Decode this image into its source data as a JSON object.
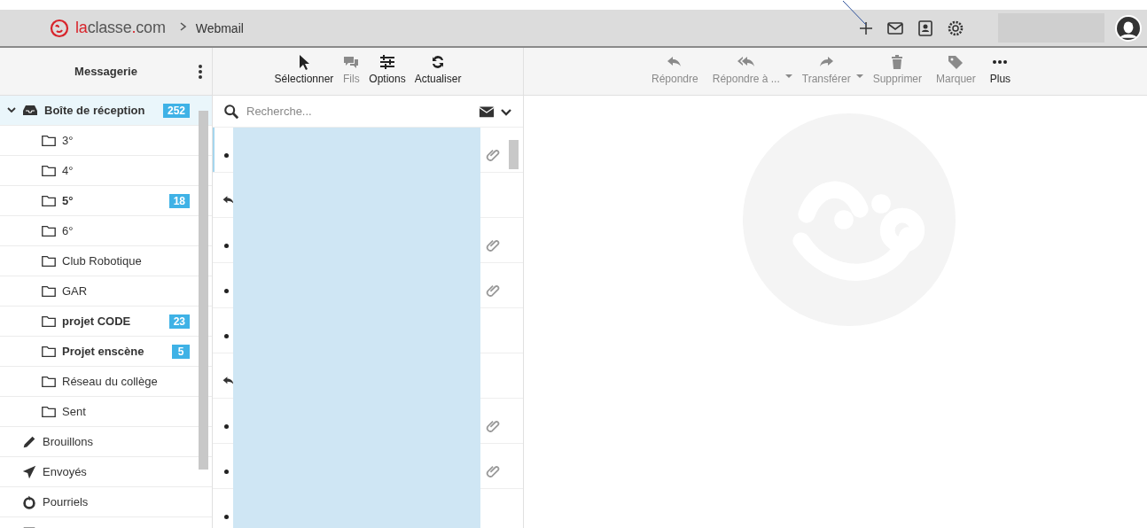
{
  "header": {
    "brand": [
      {
        "text": "la",
        "accent": true
      },
      {
        "text": "classe",
        "accent": false
      },
      {
        "text": ".",
        "accent": true
      },
      {
        "text": "com",
        "accent": false
      }
    ],
    "breadcrumb": "Webmail"
  },
  "folders": {
    "title": "Messagerie",
    "items": [
      {
        "kind": "inbox",
        "label": "Boîte de réception",
        "count": "252",
        "unread": true,
        "selected": true,
        "expanded": true,
        "children": [
          {
            "kind": "folder",
            "label": "3°",
            "unread": false,
            "selected": false
          },
          {
            "kind": "folder",
            "label": "4°",
            "unread": false,
            "selected": false
          },
          {
            "kind": "folder",
            "label": "5°",
            "count": "18",
            "unread": true,
            "selected": false
          },
          {
            "kind": "folder",
            "label": "6°",
            "unread": false,
            "selected": false
          },
          {
            "kind": "folder",
            "label": "Club Robotique",
            "unread": false,
            "selected": false
          },
          {
            "kind": "folder",
            "label": "GAR",
            "unread": false,
            "selected": false
          },
          {
            "kind": "folder",
            "label": "projet CODE",
            "count": "23",
            "unread": true,
            "selected": false
          },
          {
            "kind": "folder",
            "label": "Projet enscène",
            "count": "5",
            "unread": true,
            "selected": false
          },
          {
            "kind": "folder",
            "label": "Réseau du collège",
            "unread": false,
            "selected": false
          },
          {
            "kind": "folder",
            "label": "Sent",
            "unread": false,
            "selected": false
          }
        ]
      },
      {
        "kind": "drafts",
        "label": "Brouillons",
        "unread": false,
        "selected": false
      },
      {
        "kind": "sent",
        "label": "Envoyés",
        "unread": false,
        "selected": false
      },
      {
        "kind": "junk",
        "label": "Pourriels",
        "unread": false,
        "selected": false
      },
      {
        "kind": "trash",
        "selected": false
      }
    ]
  },
  "list_toolbar": [
    {
      "kind": "select",
      "label": "Sélectionner",
      "disabled": false
    },
    {
      "kind": "threads",
      "label": "Fils",
      "disabled": true
    },
    {
      "kind": "options",
      "label": "Options",
      "disabled": false
    },
    {
      "kind": "refresh",
      "label": "Actualiser",
      "disabled": false
    }
  ],
  "message_toolbar": [
    {
      "kind": "reply",
      "label": "Répondre",
      "disabled": true,
      "dropdown": false
    },
    {
      "kind": "reply-all",
      "label": "Répondre à ...",
      "disabled": true,
      "dropdown": true
    },
    {
      "kind": "forward",
      "label": "Transférer",
      "disabled": true,
      "dropdown": true
    },
    {
      "kind": "delete",
      "label": "Supprimer",
      "disabled": true,
      "dropdown": false
    },
    {
      "kind": "tag",
      "label": "Marquer",
      "disabled": true,
      "dropdown": false
    },
    {
      "kind": "more",
      "label": "Plus",
      "disabled": false,
      "dropdown": false
    }
  ],
  "search": {
    "placeholder": "Recherche..."
  },
  "messages": [
    {
      "kind": "unread",
      "attachment": true,
      "selected": true
    },
    {
      "kind": "replied",
      "attachment": false,
      "selected": false
    },
    {
      "kind": "unread",
      "attachment": true,
      "selected": false
    },
    {
      "kind": "unread",
      "attachment": true,
      "selected": false
    },
    {
      "kind": "unread",
      "attachment": false,
      "selected": false
    },
    {
      "kind": "replied",
      "attachment": false,
      "selected": false
    },
    {
      "kind": "unread",
      "attachment": true,
      "selected": false
    },
    {
      "kind": "unread",
      "attachment": true,
      "selected": false
    },
    {
      "kind": "unread",
      "attachment": false,
      "selected": false
    }
  ]
}
